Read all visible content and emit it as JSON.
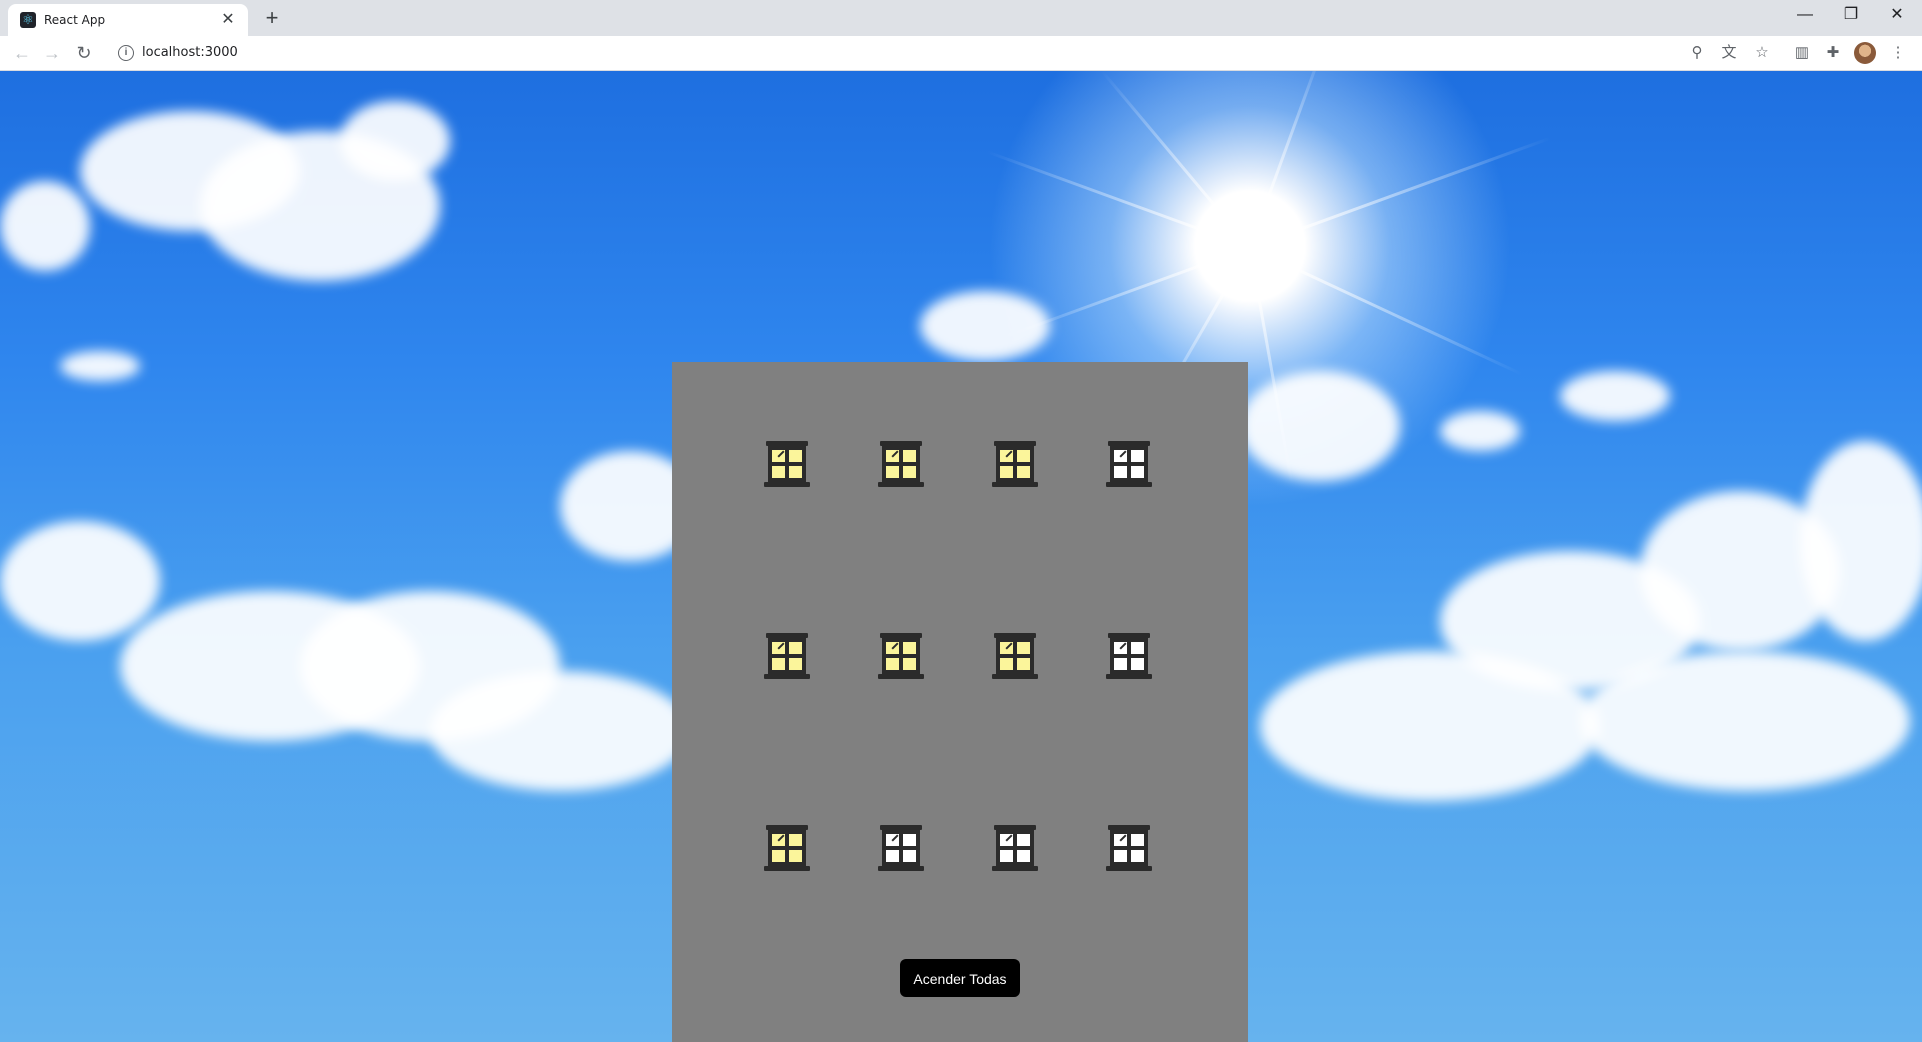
{
  "browser": {
    "tab_title": "React App",
    "tab_close": "✕",
    "new_tab": "+",
    "url": "localhost:3000",
    "window_controls": {
      "minimize": "—",
      "restore": "❐",
      "close": "✕"
    },
    "nav": {
      "back": "←",
      "forward": "→",
      "reload": "↻"
    },
    "icons": [
      "location-icon",
      "translate-icon",
      "star-icon",
      "sidebar-icon",
      "extensions-icon",
      "profile-avatar",
      "menu-icon"
    ]
  },
  "building": {
    "color": "#808080",
    "window_lit_color": "#fbf59b",
    "window_dark_color": "#ffffff",
    "windows": [
      {
        "lit": true
      },
      {
        "lit": true
      },
      {
        "lit": true
      },
      {
        "lit": false
      },
      {
        "lit": true
      },
      {
        "lit": true
      },
      {
        "lit": true
      },
      {
        "lit": false
      },
      {
        "lit": true
      },
      {
        "lit": false
      },
      {
        "lit": false
      },
      {
        "lit": false
      }
    ],
    "button_label": "Acender Todas"
  }
}
